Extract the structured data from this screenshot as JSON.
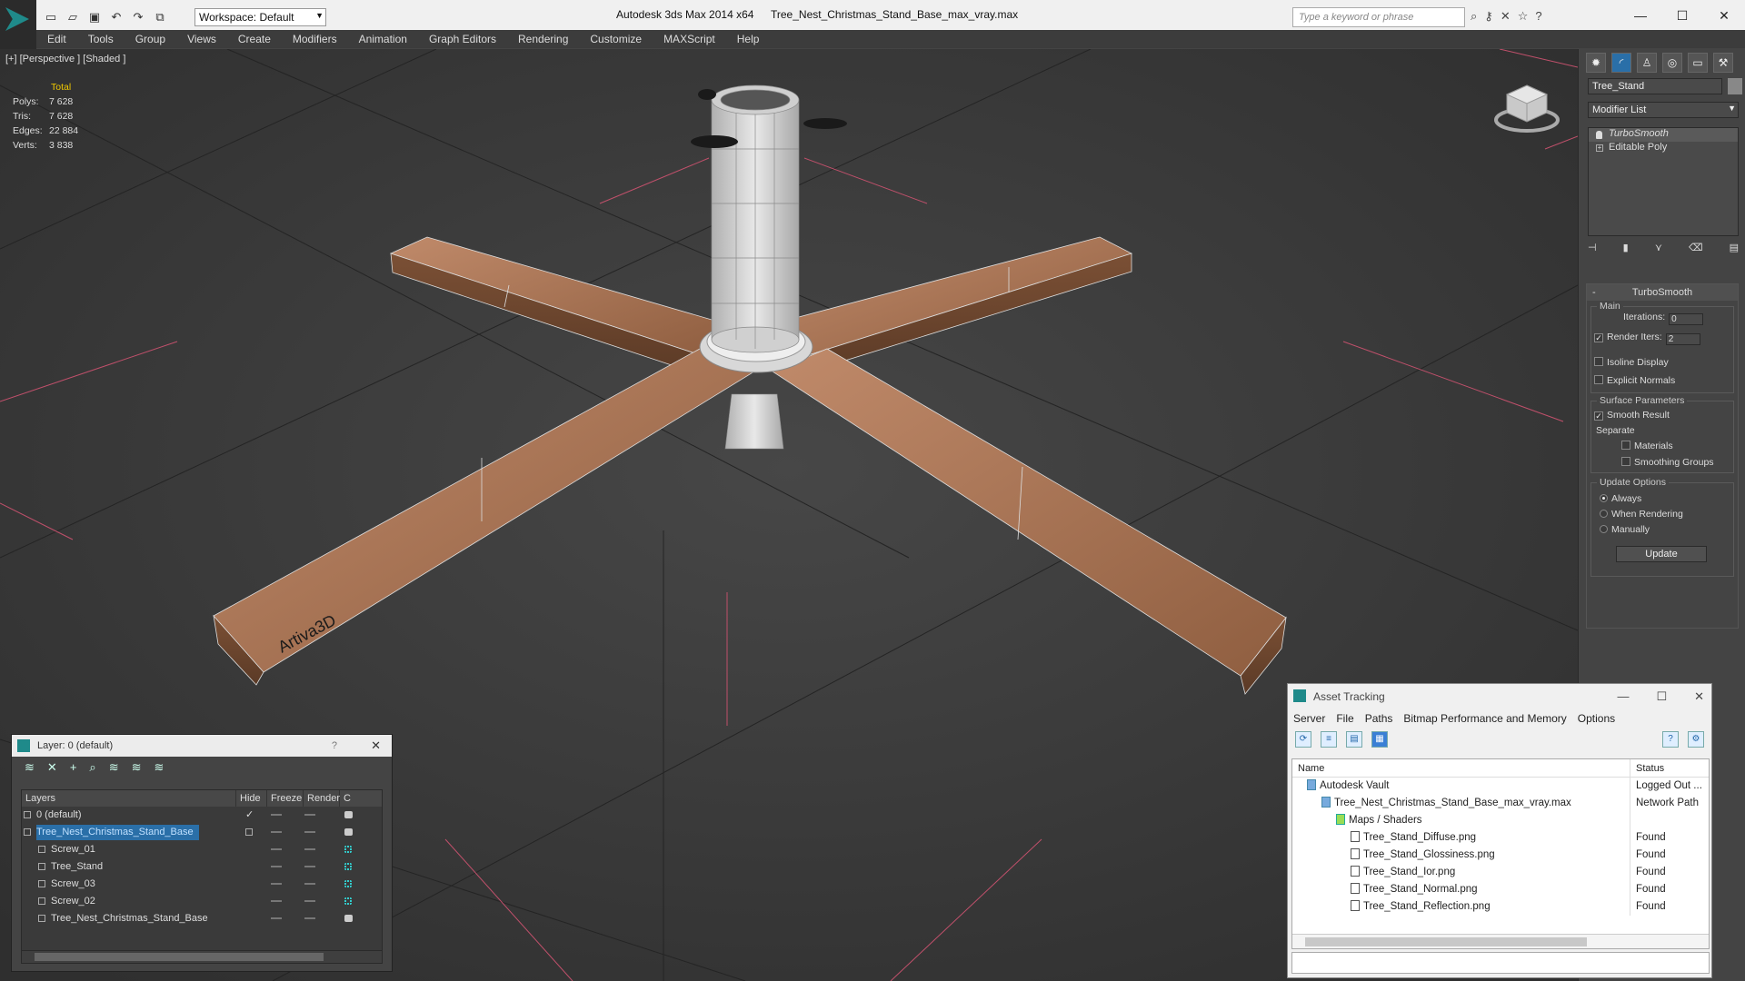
{
  "titlebar": {
    "app_title": "Autodesk 3ds Max  2014 x64",
    "file_title": "Tree_Nest_Christmas_Stand_Base_max_vray.max",
    "workspace": "Workspace: Default",
    "search_placeholder": "Type a keyword or phrase"
  },
  "menu": [
    "Edit",
    "Tools",
    "Group",
    "Views",
    "Create",
    "Modifiers",
    "Animation",
    "Graph Editors",
    "Rendering",
    "Customize",
    "MAXScript",
    "Help"
  ],
  "viewport": {
    "label": "[+] [Perspective ] [Shaded ]",
    "stats_header": "Total",
    "stats": [
      {
        "k": "Polys:",
        "v": "7 628"
      },
      {
        "k": "Tris:",
        "v": "7 628"
      },
      {
        "k": "Edges:",
        "v": "22 884"
      },
      {
        "k": "Verts:",
        "v": "3 838"
      }
    ],
    "watermark": "Artiva3D"
  },
  "command_panel": {
    "object_name": "Tree_Stand",
    "modifier_list": "Modifier List",
    "stack": [
      "TurboSmooth",
      "Editable Poly"
    ],
    "rollout_title": "TurboSmooth",
    "main_group": "Main",
    "iterations_label": "Iterations:",
    "iterations_value": "0",
    "render_iters_label": "Render Iters:",
    "render_iters_value": "2",
    "render_iters_checked": true,
    "isoline_label": "Isoline Display",
    "explicit_normals_label": "Explicit Normals",
    "surface_group": "Surface Parameters",
    "smooth_result_label": "Smooth Result",
    "separate_label": "Separate",
    "materials_label": "Materials",
    "smoothing_groups_label": "Smoothing Groups",
    "update_group": "Update Options",
    "update_always": "Always",
    "update_rendering": "When Rendering",
    "update_manually": "Manually",
    "update_button": "Update"
  },
  "layer_dialog": {
    "title": "Layer: 0 (default)",
    "help": "?",
    "columns": [
      "Layers",
      "Hide",
      "Freeze",
      "Render",
      "C"
    ],
    "rows": [
      {
        "name": "0 (default)",
        "indent": 0,
        "render": "box",
        "check": true,
        "sel": false
      },
      {
        "name": "Tree_Nest_Christmas_Stand_Base",
        "indent": 0,
        "render": "box",
        "check": false,
        "sel": true
      },
      {
        "name": "Screw_01",
        "indent": 1,
        "render": "teal",
        "check": false,
        "sel": false
      },
      {
        "name": "Tree_Stand",
        "indent": 1,
        "render": "teal",
        "check": false,
        "sel": false
      },
      {
        "name": "Screw_03",
        "indent": 1,
        "render": "teal",
        "check": false,
        "sel": false
      },
      {
        "name": "Screw_02",
        "indent": 1,
        "render": "teal",
        "check": false,
        "sel": false
      },
      {
        "name": "Tree_Nest_Christmas_Stand_Base",
        "indent": 1,
        "render": "box",
        "check": false,
        "sel": false
      }
    ]
  },
  "asset_dialog": {
    "title": "Asset Tracking",
    "menu": [
      "Server",
      "File",
      "Paths",
      "Bitmap Performance and Memory",
      "Options"
    ],
    "columns": [
      "Name",
      "Status"
    ],
    "rows": [
      {
        "name": "Autodesk Vault",
        "status": "Logged Out ...",
        "indent": 0,
        "icon": "vault"
      },
      {
        "name": "Tree_Nest_Christmas_Stand_Base_max_vray.max",
        "status": "Network Path",
        "indent": 1,
        "icon": "max"
      },
      {
        "name": "Maps / Shaders",
        "status": "",
        "indent": 2,
        "icon": "folder"
      },
      {
        "name": "Tree_Stand_Diffuse.png",
        "status": "Found",
        "indent": 3,
        "icon": "file"
      },
      {
        "name": "Tree_Stand_Glossiness.png",
        "status": "Found",
        "indent": 3,
        "icon": "file"
      },
      {
        "name": "Tree_Stand_Ior.png",
        "status": "Found",
        "indent": 3,
        "icon": "file"
      },
      {
        "name": "Tree_Stand_Normal.png",
        "status": "Found",
        "indent": 3,
        "icon": "file"
      },
      {
        "name": "Tree_Stand_Reflection.png",
        "status": "Found",
        "indent": 3,
        "icon": "file"
      }
    ]
  }
}
